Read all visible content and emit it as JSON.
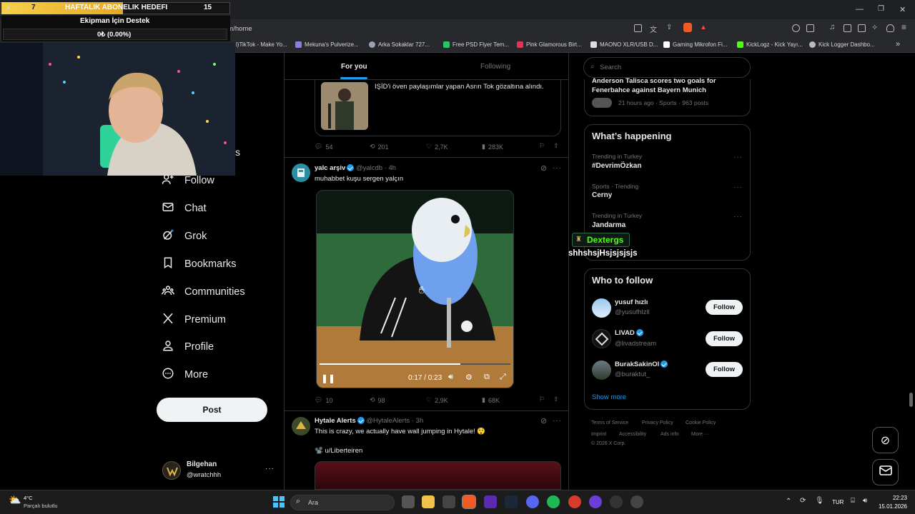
{
  "overlay": {
    "goal_left": "7",
    "goal_title": "HAFTALIK ABONELIK HEDEFI",
    "goal_right": "15",
    "donate_title": "Ekipman İçin Destek",
    "donate_amount": "0₺ (0.00%)"
  },
  "browser": {
    "url": "om/home",
    "bookmarks": [
      "l)TikTok - Make Yo...",
      "Mekuna's Pulverize...",
      "Arka Sokaklar 727...",
      "Free PSD Flyer Tem...",
      "Pink Glamorous Birt...",
      "MAONO XLR/USB D...",
      "Gaming Mikrofon Fi...",
      "KickLogz - Kick Yayı...",
      "Kick Logger Dashbo..."
    ]
  },
  "nav": {
    "items": [
      "Follow",
      "Chat",
      "Grok",
      "Bookmarks",
      "Communities",
      "Premium",
      "Profile",
      "More"
    ],
    "post": "Post",
    "user_name": "Bilgehan",
    "user_handle": "@wratchhh",
    "partial_letter": "s"
  },
  "feed": {
    "tabs": [
      "For you",
      "Following"
    ],
    "tweet0": {
      "quote_text": "IŞİD'i öven paylaşımlar yapan Asrın Tok gözaltına alındı.",
      "replies": "54",
      "reposts": "201",
      "likes": "2,7K",
      "views": "283K"
    },
    "tweet1": {
      "name": "yalc arşiv",
      "handle": "@yalcdb",
      "time": "· 4h",
      "text": "muhabbet kuşu sergen yalçın",
      "video_time": "0:17 / 0:23",
      "replies": "10",
      "reposts": "98",
      "likes": "2,9K",
      "views": "68K"
    },
    "tweet2": {
      "name": "Hytale Alerts",
      "handle": "@HytaleAlerts",
      "time": "· 3h",
      "text": "This is crazy, we actually have wall jumping in Hytale! 😲",
      "credit": "📽️ u/Liberteiren"
    }
  },
  "right": {
    "search_placeholder": "Search",
    "top_news": {
      "title": "Anderson Talisca scores two goals for Fenerbahce against Bayern Munich",
      "meta": "21 hours ago · Sports · 963 posts"
    },
    "happening": {
      "title": "What’s happening",
      "trends": [
        {
          "meta": "Trending in Turkey",
          "name": "#DevrimÖzkan"
        },
        {
          "meta": "Sports · Trending",
          "name": "Cerny"
        },
        {
          "meta": "Trending in Turkey",
          "name": "Jandarma"
        }
      ]
    },
    "popup": {
      "name": "Dextergs",
      "message": "shhshsjHsjsjsjsjs"
    },
    "who": {
      "title": "Who to follow",
      "users": [
        {
          "name": "yusuf hızlı",
          "handle": "@yusufhlzll",
          "btn": "Follow"
        },
        {
          "name": "LIVAD",
          "handle": "@livadstream",
          "btn": "Follow"
        },
        {
          "name": "BurakSakinOl",
          "handle": "@buraktut_",
          "btn": "Follow"
        }
      ],
      "show_more": "Show more"
    },
    "footer": [
      "Terms of Service",
      "Privacy Policy",
      "Cookie Policy",
      "Imprint",
      "Accessibility",
      "Ads info",
      "More ···",
      "© 2026 X Corp."
    ]
  },
  "taskbar": {
    "temp": "4°C",
    "weather": "Parçalı bulutlu",
    "search": "Ara",
    "lang": "TUR",
    "time": "22:23",
    "date": "15.01.2026"
  }
}
